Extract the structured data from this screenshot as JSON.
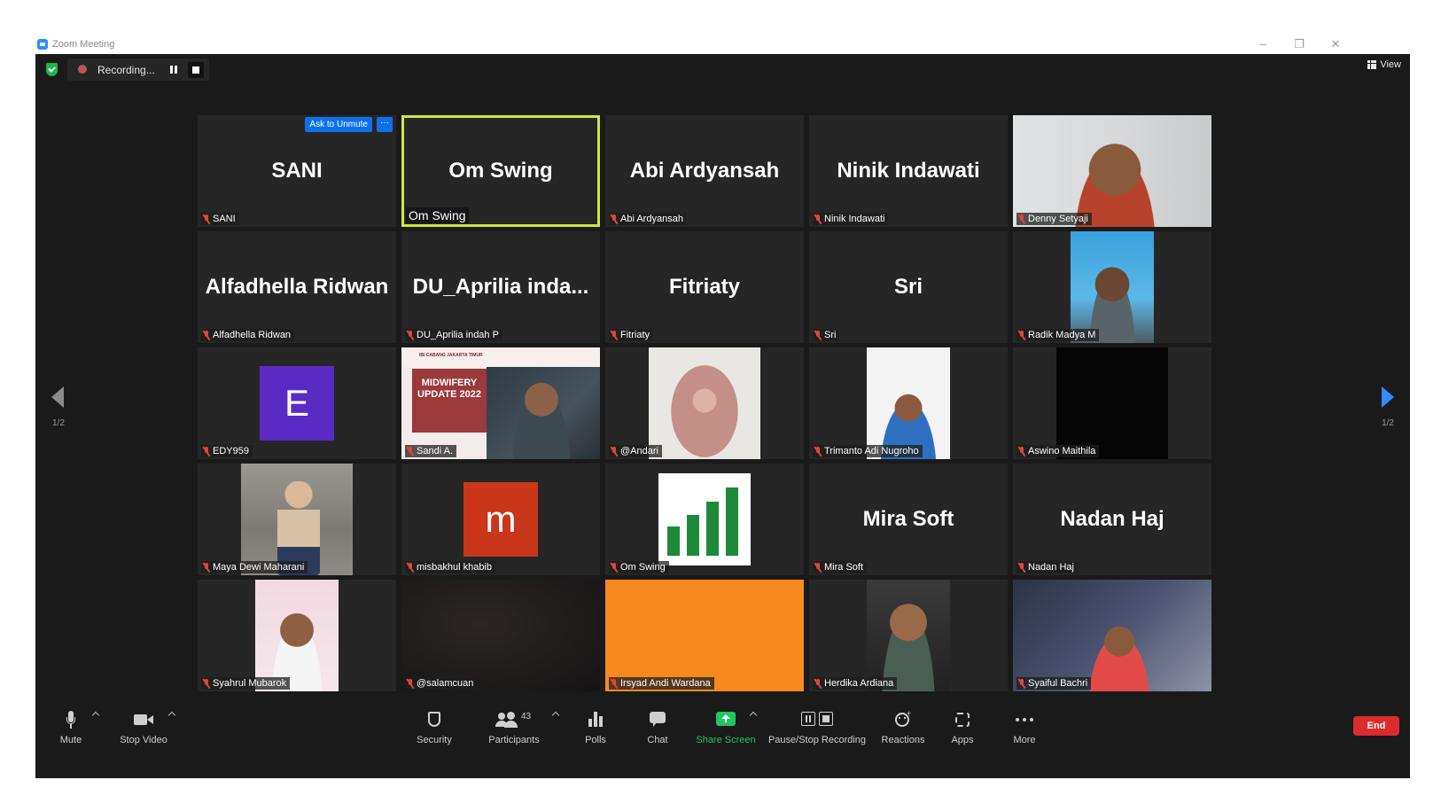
{
  "window": {
    "title": "Zoom Meeting"
  },
  "recording": {
    "label": "Recording..."
  },
  "view": {
    "label": "View"
  },
  "pagination": {
    "left": "1/2",
    "right": "1/2"
  },
  "spotlight": {
    "ask_to_unmute": "Ask to Unmute",
    "more": "···"
  },
  "tiles": [
    {
      "display": "SANI",
      "name": "SANI",
      "type": "name"
    },
    {
      "display": "Om Swing",
      "name": "Om Swing",
      "type": "name-active"
    },
    {
      "display": "Abi Ardyansah",
      "name": "Abi Ardyansah",
      "type": "name"
    },
    {
      "display": "Ninik Indawati",
      "name": "Ninik Indawati",
      "type": "name"
    },
    {
      "name": "Denny Setyaji",
      "type": "video"
    },
    {
      "display": "Alfadhella Ridwan",
      "name": "Alfadhella Ridwan",
      "type": "name"
    },
    {
      "display": "DU_Aprilia  inda...",
      "name": "DU_Aprilia indah P",
      "type": "name"
    },
    {
      "display": "Fitriaty",
      "name": "Fitriaty",
      "type": "name"
    },
    {
      "display": "Sri",
      "name": "Sri",
      "type": "name"
    },
    {
      "name": "Radik Madya M",
      "type": "video"
    },
    {
      "avatar_letter": "E",
      "avatar_color": "#5a2bc4",
      "name": "EDY959",
      "type": "avatar"
    },
    {
      "name": "Sandi A.",
      "type": "video",
      "banner_top": "IBI CABANG JAKARTA TIMUR",
      "banner_title": "MIDWIFERY UPDATE 2022"
    },
    {
      "name": "@Andari",
      "type": "video"
    },
    {
      "name": "Trimanto Adi Nugroho",
      "type": "video"
    },
    {
      "name": "Aswino Maithila",
      "type": "video"
    },
    {
      "name": "Maya Dewi Maharani",
      "type": "video"
    },
    {
      "avatar_letter": "m",
      "avatar_color": "#c9361a",
      "name": "misbakhul khabib",
      "type": "avatar"
    },
    {
      "name": "Om Swing",
      "type": "video"
    },
    {
      "display": "Mira Soft",
      "name": "Mira Soft",
      "type": "name"
    },
    {
      "display": "Nadan Haj",
      "name": "Nadan Haj",
      "type": "name"
    },
    {
      "name": "Syahrul Mubarok",
      "type": "video"
    },
    {
      "name": "@salamcuan",
      "type": "video"
    },
    {
      "name": "Irsyad Andi Wardana",
      "type": "video"
    },
    {
      "name": "Herdika Ardiana",
      "type": "video"
    },
    {
      "name": "Syaiful Bachri",
      "type": "video"
    }
  ],
  "toolbar": {
    "mute": "Mute",
    "stop_video": "Stop Video",
    "security": "Security",
    "participants": "Participants",
    "participants_count": "43",
    "polls": "Polls",
    "chat": "Chat",
    "share_screen": "Share Screen",
    "pause_stop_recording": "Pause/Stop Recording",
    "reactions": "Reactions",
    "apps": "Apps",
    "more": "More",
    "end": "End"
  },
  "colors": {
    "accent": "#2d8cff",
    "active_speaker": "#cde840",
    "share_green": "#22c55e",
    "end_red": "#d92d2d",
    "muted_red": "#e0443c"
  }
}
